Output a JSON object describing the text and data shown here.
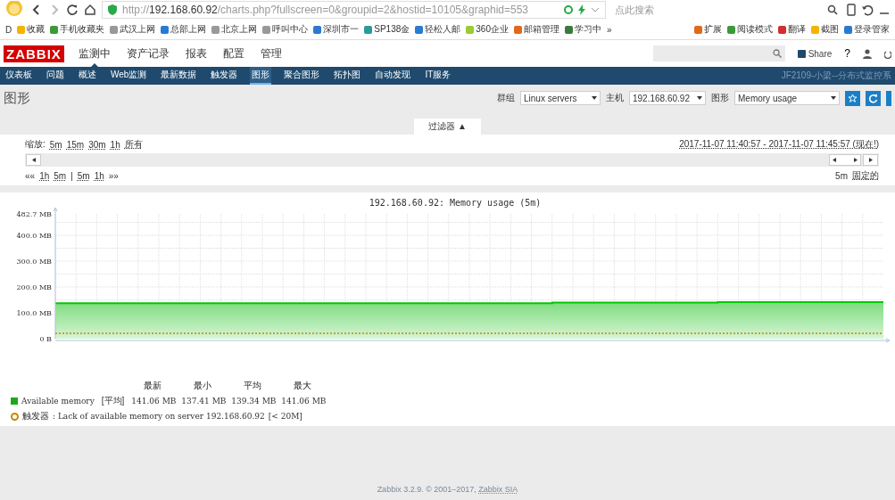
{
  "browser": {
    "address": "http://**192.168.60.92**/charts.php?fullscreen=0&groupid=2&hostid=10105&graphid=553",
    "search_placeholder": "点此搜索",
    "bookmarks_lead": "D",
    "bookmarks": [
      "收藏",
      "手机收藏夹",
      "武汉上网",
      "总部上网",
      "北京上网",
      "呼叫中心",
      "深圳市一",
      "SP138金",
      "轻松人邮",
      "360企业",
      "邮箱管理",
      "学习中"
    ],
    "more": "»",
    "extensions": [
      "扩展",
      "阅读模式",
      "翻译",
      "截图",
      "登录管家"
    ]
  },
  "header": {
    "logo": "ZABBIX",
    "menu": [
      {
        "label": "监测中",
        "selected": true
      },
      {
        "label": "资产记录",
        "selected": false
      },
      {
        "label": "报表",
        "selected": false
      },
      {
        "label": "配置",
        "selected": false
      },
      {
        "label": "管理",
        "selected": false
      }
    ],
    "share": "Share",
    "help": "?"
  },
  "subnav": {
    "items": [
      {
        "label": "仪表板",
        "selected": false
      },
      {
        "label": "问题",
        "selected": false
      },
      {
        "label": "概述",
        "selected": false
      },
      {
        "label": "Web监测",
        "selected": false
      },
      {
        "label": "最新数据",
        "selected": false
      },
      {
        "label": "触发器",
        "selected": false
      },
      {
        "label": "图形",
        "selected": true
      },
      {
        "label": "聚合图形",
        "selected": false
      },
      {
        "label": "拓扑图",
        "selected": false
      },
      {
        "label": "自动发现",
        "selected": false
      },
      {
        "label": "IT服务",
        "selected": false
      }
    ],
    "server_name": "JF2109-小梁--分布式监控系"
  },
  "page": {
    "title": "图形",
    "selectors": [
      {
        "label": "群组",
        "value": "Linux servers"
      },
      {
        "label": "主机",
        "value": "192.168.60.92"
      },
      {
        "label": "图形",
        "value": "Memory usage"
      }
    ]
  },
  "filter": {
    "tab": "过滤器 ▲",
    "zoom_label": "缩放:",
    "zoom_options": [
      "5m",
      "15m",
      "30m",
      "1h",
      "所有"
    ],
    "range": "2017-11-07 11:40:57 - 2017-11-07 11:45:57 (现在!)",
    "back_links": [
      "««",
      "1h",
      "5m",
      "|",
      "5m",
      "1h",
      "»»"
    ],
    "period": "5m",
    "fixed": "固定的"
  },
  "graph": {
    "chart_data": {
      "type": "area",
      "title": "192.168.60.92: Memory usage (5m)",
      "ylim": [
        0,
        482.7
      ],
      "grid": true,
      "yticks": [
        {
          "value": 0,
          "label": "0 B"
        },
        {
          "value": 100,
          "label": "100.0 MB"
        },
        {
          "value": 200,
          "label": "200.0 MB"
        },
        {
          "value": 300,
          "label": "300.0 MB"
        },
        {
          "value": 400,
          "label": "400.0 MB"
        },
        {
          "value": 482.7,
          "label": "482.7 MB"
        }
      ],
      "series": [
        {
          "name": "Available memory",
          "color": "#00c800",
          "values": [
            137,
            137,
            137,
            137,
            137,
            137,
            140,
            140,
            141,
            141,
            141
          ]
        }
      ]
    },
    "legend_header": [
      "最新",
      "最小",
      "平均",
      "最大"
    ],
    "legend": [
      {
        "kind": "item",
        "color": "#1ca81c",
        "func": "[平均]",
        "values": [
          "141.06 MB",
          "137.41 MB",
          "139.34 MB",
          "141.06 MB"
        ]
      },
      {
        "kind": "trigger",
        "color": "#c88400",
        "name": "触发器",
        "text": ": Lack of available memory on server 192.168.60.92",
        "condition": "[< 20M]"
      }
    ]
  },
  "footer": {
    "text": "Zabbix 3.2.9. © 2001–2017, ",
    "link": "Zabbix SIA"
  }
}
